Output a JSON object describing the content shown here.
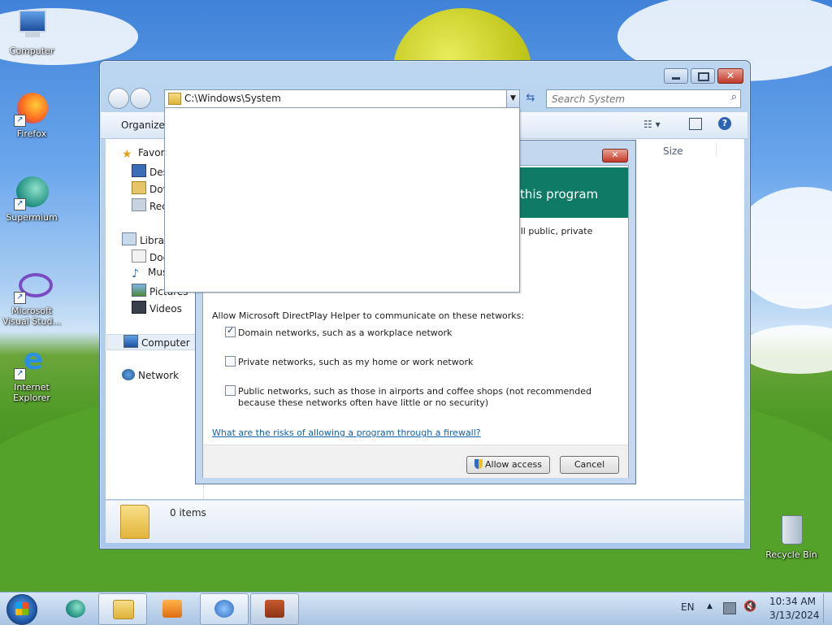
{
  "desktop": {
    "icons": [
      {
        "name": "desktop-icon-computer",
        "label": "Computer"
      },
      {
        "name": "desktop-icon-firefox",
        "label": "Firefox"
      },
      {
        "name": "desktop-icon-supermium",
        "label": "Supermium"
      },
      {
        "name": "desktop-icon-visual-studio",
        "label": "Microsoft Visual Stud..."
      },
      {
        "name": "desktop-icon-internet-explorer",
        "label": "Internet Explorer"
      },
      {
        "name": "desktop-icon-recycle-bin",
        "label": "Recycle Bin"
      }
    ]
  },
  "explorer": {
    "address": "C:\\Windows\\System",
    "search_placeholder": "Search System",
    "organize_label": "Organize",
    "column_size": "Size",
    "status_items": "0 items",
    "nav": {
      "favorites": "Favorites",
      "desktop": "Desktop",
      "downloads": "Downloads",
      "recent": "Recent Places",
      "libraries": "Libraries",
      "documents": "Documents",
      "music": "Music",
      "pictures": "Pictures",
      "videos": "Videos",
      "computer": "Computer",
      "network": "Network"
    }
  },
  "dialog": {
    "header_title": "this program",
    "description_fragment": "all public, private",
    "networks_label": "Allow Microsoft DirectPlay Helper to communicate on these networks:",
    "options": [
      {
        "label": "Domain networks, such as a workplace network",
        "checked": true
      },
      {
        "label": "Private networks, such as my home or work network",
        "checked": false
      },
      {
        "label": "Public networks, such as those in airports and coffee shops (not recommended",
        "label2": "because these networks often have little or no security)",
        "checked": false
      }
    ],
    "risk_link": "What are the risks of allowing a program through a firewall?",
    "allow_button": "Allow access",
    "cancel_button": "Cancel"
  },
  "taskbar": {
    "language": "EN",
    "time": "10:34 AM",
    "date": "3/13/2024"
  }
}
